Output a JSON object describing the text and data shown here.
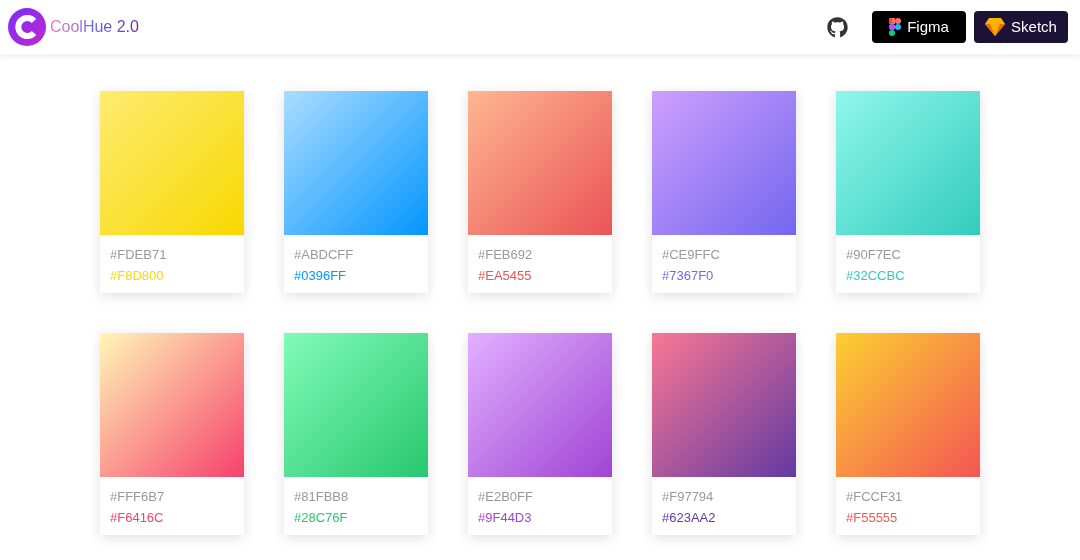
{
  "header": {
    "logo_text": "CoolHue 2.0",
    "buttons": [
      {
        "kind": "figma",
        "label": "Figma"
      },
      {
        "kind": "sketch",
        "label": "Sketch"
      }
    ]
  },
  "cards": [
    {
      "start": "#FDEB71",
      "end": "#F8D800",
      "color": "#f8d800"
    },
    {
      "start": "#ABDCFF",
      "end": "#0396FF",
      "color": "#0396ff"
    },
    {
      "start": "#FEB692",
      "end": "#EA5455",
      "color": "#ea5455"
    },
    {
      "start": "#CE9FFC",
      "end": "#7367F0",
      "color": "#7367f0"
    },
    {
      "start": "#90F7EC",
      "end": "#32CCBC",
      "color": "#32ccbc"
    },
    {
      "start": "#FFF6B7",
      "end": "#F6416C",
      "color": "#f6416c"
    },
    {
      "start": "#81FBB8",
      "end": "#28C76F",
      "color": "#28c76f"
    },
    {
      "start": "#E2B0FF",
      "end": "#9F44D3",
      "color": "#9f44d3"
    },
    {
      "start": "#F97794",
      "end": "#623AA2",
      "color": "#623aa2"
    },
    {
      "start": "#FCCF31",
      "end": "#F55555",
      "color": "#f55555"
    }
  ]
}
